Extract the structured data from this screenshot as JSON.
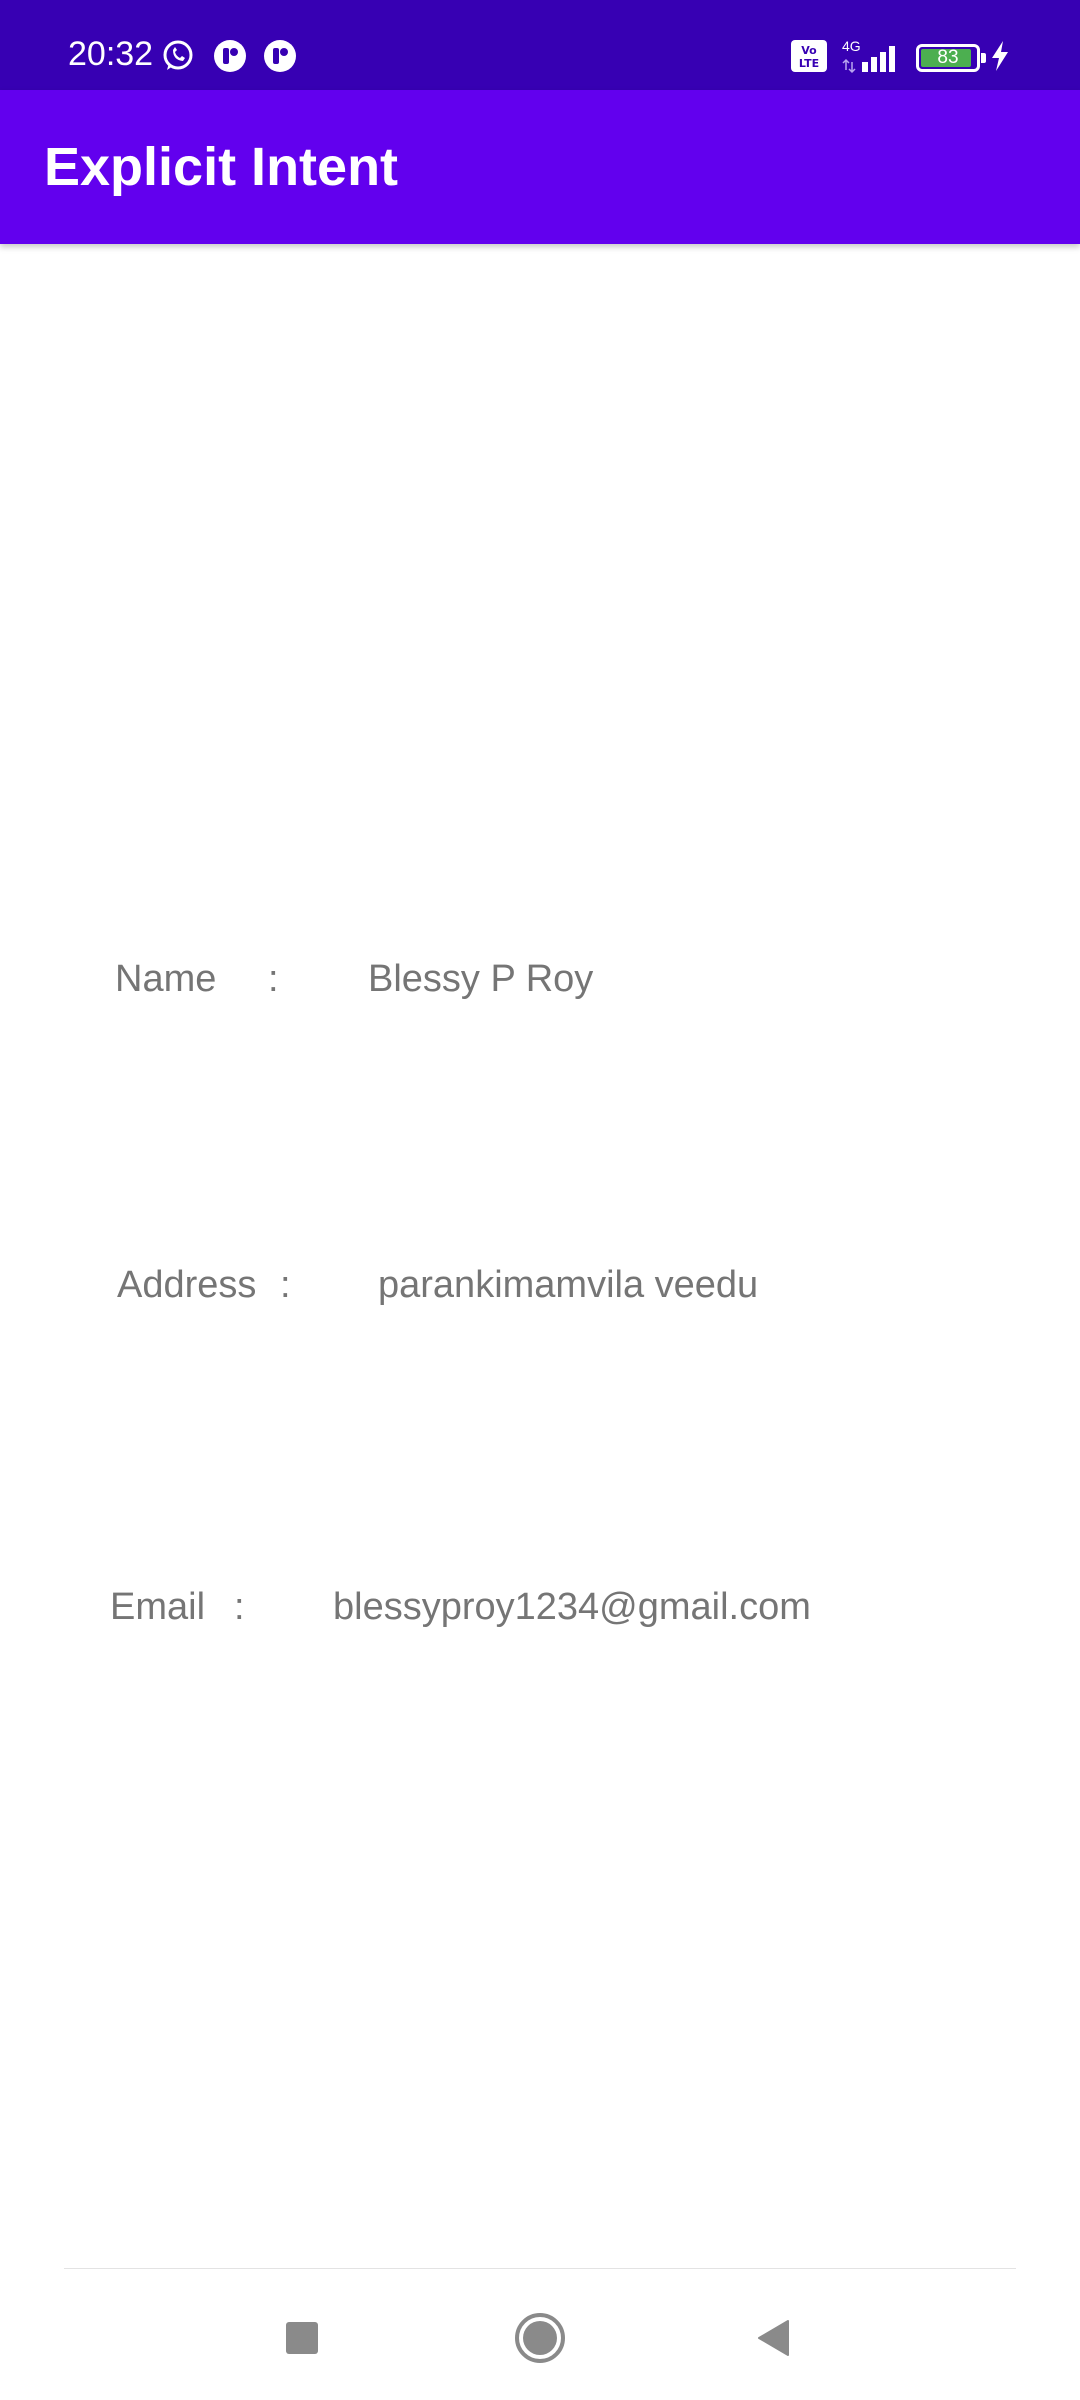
{
  "status_bar": {
    "time": "20:32",
    "battery_level": "83",
    "network_type": "4G",
    "volte_label": "Vo LTE",
    "icons": [
      "whatsapp-icon",
      "notification-icon",
      "notification-icon",
      "volte-icon",
      "signal-icon",
      "battery-icon",
      "charging-icon"
    ]
  },
  "app_bar": {
    "title": "Explicit Intent"
  },
  "fields": {
    "name_label": "Name",
    "name_colon": ":",
    "name_value": "Blessy P Roy",
    "address_label": "Address",
    "address_colon": ":",
    "address_value": "parankimamvila veedu",
    "email_label": "Email",
    "email_colon": ":",
    "email_value": "blessyproy1234@gmail.com"
  },
  "nav_bar": {
    "buttons": [
      "recents-icon",
      "home-icon",
      "back-icon"
    ]
  },
  "colors": {
    "status_bar": "#3700b3",
    "app_bar": "#6200ee",
    "text": "#757575",
    "background": "#ffffff"
  }
}
